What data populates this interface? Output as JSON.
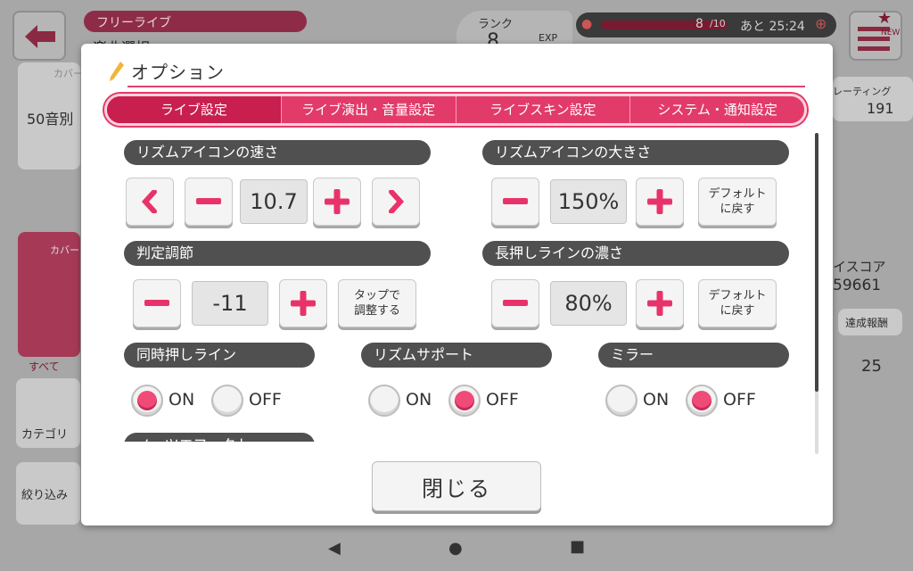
{
  "background": {
    "screen_title": "フリーライブ",
    "sub_title": "楽曲選択",
    "rank_label": "ランク",
    "rank_value": "8",
    "exp_label": "EXP",
    "stamina_text": "8",
    "stamina_max": "/10",
    "stamina_timer": "あと 25:24",
    "new_badge": "NEW",
    "left_items": [
      "カバー",
      "50音別",
      "カバー",
      "すべて",
      "カテゴリ",
      "絞り込み"
    ],
    "right_items": [
      "レーティング",
      "191",
      "イスコア",
      "59661",
      "達成報酬",
      "25"
    ]
  },
  "modal": {
    "title": "オプション",
    "tabs": [
      {
        "label": "ライブ設定",
        "active": true
      },
      {
        "label": "ライブ演出・音量設定",
        "active": false
      },
      {
        "label": "ライブスキン設定",
        "active": false
      },
      {
        "label": "システム・通知設定",
        "active": false
      }
    ],
    "icon_speed": {
      "label": "リズムアイコンの速さ",
      "value": "10.7"
    },
    "icon_size": {
      "label": "リズムアイコンの大きさ",
      "value": "150%",
      "reset_label": "デフォルト\nに戻す"
    },
    "judge_adjust": {
      "label": "判定調節",
      "value": "-11",
      "tap_label": "タップで\n調整する"
    },
    "long_line": {
      "label": "長押しラインの濃さ",
      "value": "80%",
      "reset_label": "デフォルト\nに戻す"
    },
    "sync_line": {
      "label": "同時押しライン",
      "on_label": "ON",
      "off_label": "OFF",
      "selected": "ON"
    },
    "rhythm_support": {
      "label": "リズムサポート",
      "on_label": "ON",
      "off_label": "OFF",
      "selected": "OFF"
    },
    "mirror": {
      "label": "ミラー",
      "on_label": "ON",
      "off_label": "OFF",
      "selected": "OFF"
    },
    "next_section": {
      "label": "ノーツエフェクト"
    },
    "close_label": "閉じる"
  },
  "colors": {
    "accent": "#e23a69",
    "label_bg": "#505050",
    "radio_on": "#f04a78"
  }
}
